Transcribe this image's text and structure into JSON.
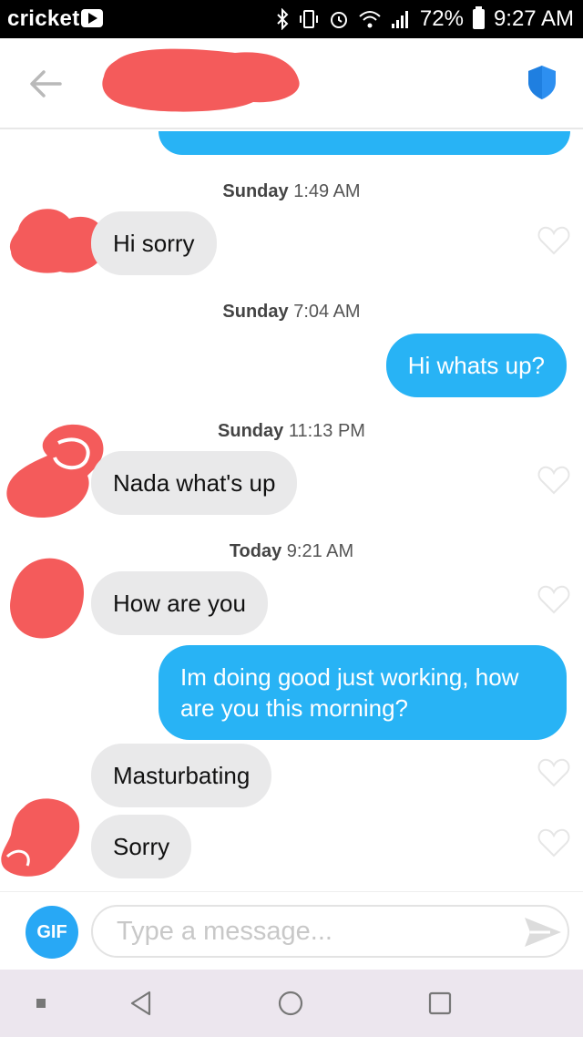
{
  "status_bar": {
    "carrier": "cricket",
    "battery": "72%",
    "time": "9:27 AM",
    "icons": [
      "bluetooth-icon",
      "vibrate-icon",
      "alarm-icon",
      "wifi-icon",
      "signal-icon",
      "battery-icon"
    ]
  },
  "header": {
    "back_icon": "arrow-left-icon",
    "shield_icon": "shield-icon",
    "colors": {
      "shield": "#2d8ff0",
      "back": "#b9b9b9"
    }
  },
  "messages": [
    {
      "type": "timestamp",
      "day": "Sunday",
      "time": "1:49 AM"
    },
    {
      "type": "incoming",
      "text": "Hi sorry"
    },
    {
      "type": "timestamp",
      "day": "Sunday",
      "time": "7:04 AM"
    },
    {
      "type": "outgoing",
      "text": "Hi whats up?"
    },
    {
      "type": "timestamp",
      "day": "Sunday",
      "time": "11:13 PM"
    },
    {
      "type": "incoming",
      "text": "Nada what's up"
    },
    {
      "type": "timestamp",
      "day": "Today",
      "time": "9:21 AM"
    },
    {
      "type": "incoming",
      "text": "How are you"
    },
    {
      "type": "outgoing",
      "text": "Im doing good just working, how are you this morning?"
    },
    {
      "type": "incoming",
      "text": "Masturbating"
    },
    {
      "type": "incoming",
      "text": "Sorry"
    }
  ],
  "input_bar": {
    "gif_label": "GIF",
    "placeholder": "Type a message...",
    "send_icon": "send-icon"
  },
  "colors": {
    "outgoing_bubble": "#28b3f5",
    "incoming_bubble": "#e9e9ea",
    "redaction": "#f45b5b"
  },
  "nav_bar": {
    "icons": [
      "recent-dot-icon",
      "back-triangle-icon",
      "home-circle-icon",
      "overview-square-icon"
    ]
  }
}
